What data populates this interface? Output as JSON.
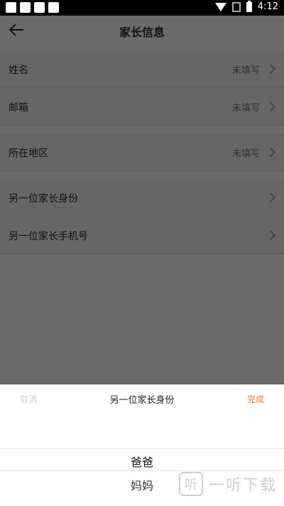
{
  "status_bar": {
    "time": "4:12"
  },
  "header": {
    "title": "家长信息"
  },
  "rows": [
    {
      "label": "姓名",
      "value": "未填写"
    },
    {
      "label": "邮箱",
      "value": "未填写"
    },
    {
      "label": "所在地区",
      "value": "未填写"
    },
    {
      "label": "另一位家长身份",
      "value": ""
    },
    {
      "label": "另一位家长手机号",
      "value": ""
    }
  ],
  "sheet": {
    "cancel_label": "取消",
    "title": "另一位家长身份",
    "done_label": "完成",
    "options": [
      "爸爸",
      "妈妈"
    ]
  },
  "watermark": {
    "logo": "听",
    "text": "一听下载"
  },
  "colors": {
    "accent": "#f07a2b"
  }
}
